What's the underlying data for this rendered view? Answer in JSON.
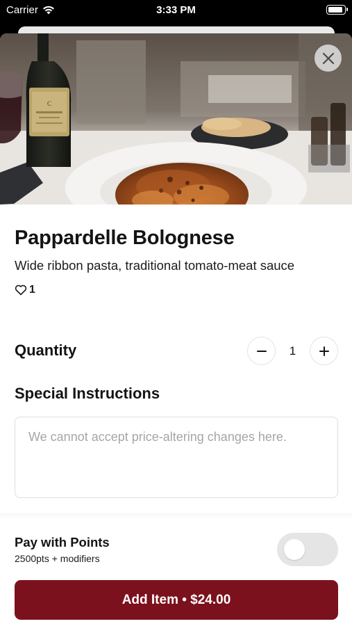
{
  "status_bar": {
    "carrier": "Carrier",
    "time": "3:33 PM"
  },
  "item": {
    "name": "Pappardelle Bolognese",
    "description": "Wide ribbon pasta, traditional tomato-meat sauce",
    "likes": "1",
    "image_icon": "food-photo"
  },
  "quantity": {
    "label": "Quantity",
    "value": "1",
    "decrement_icon": "minus-icon",
    "increment_icon": "plus-icon"
  },
  "instructions": {
    "label": "Special Instructions",
    "placeholder": "We cannot accept price-altering changes here.",
    "value": ""
  },
  "points": {
    "title": "Pay with Points",
    "subtitle": "2500pts + modifiers",
    "toggle_on": false
  },
  "add_button": {
    "label": "Add Item • $24.00"
  },
  "colors": {
    "accent": "#7b111c",
    "toggle_off": "#e5e5e5"
  }
}
